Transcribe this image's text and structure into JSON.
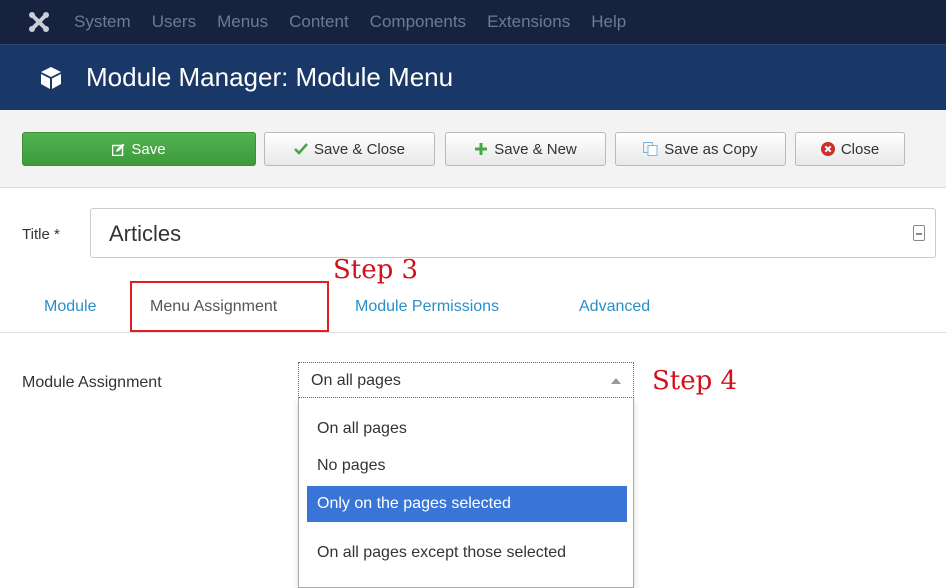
{
  "nav": {
    "items": [
      "System",
      "Users",
      "Menus",
      "Content",
      "Components",
      "Extensions",
      "Help"
    ]
  },
  "header": {
    "title": "Module Manager: Module Menu"
  },
  "toolbar": {
    "save": "Save",
    "save_close": "Save & Close",
    "save_new": "Save & New",
    "save_copy": "Save as Copy",
    "close": "Close"
  },
  "form": {
    "title_label": "Title *",
    "title_value": "Articles"
  },
  "tabs": [
    "Module",
    "Menu Assignment",
    "Module Permissions",
    "Advanced"
  ],
  "annotations": {
    "step3": "Step 3",
    "step4": "Step 4"
  },
  "assignment": {
    "label": "Module Assignment",
    "selected": "On all pages",
    "options": [
      "On all pages",
      "No pages",
      "Only on the pages selected",
      "On all pages except those selected"
    ]
  },
  "colors": {
    "nav_bg": "#17233e",
    "header_bg": "#1a3867",
    "save_green": "#46a546",
    "highlight_blue": "#3875d7",
    "annotation_red": "#d0101a"
  }
}
